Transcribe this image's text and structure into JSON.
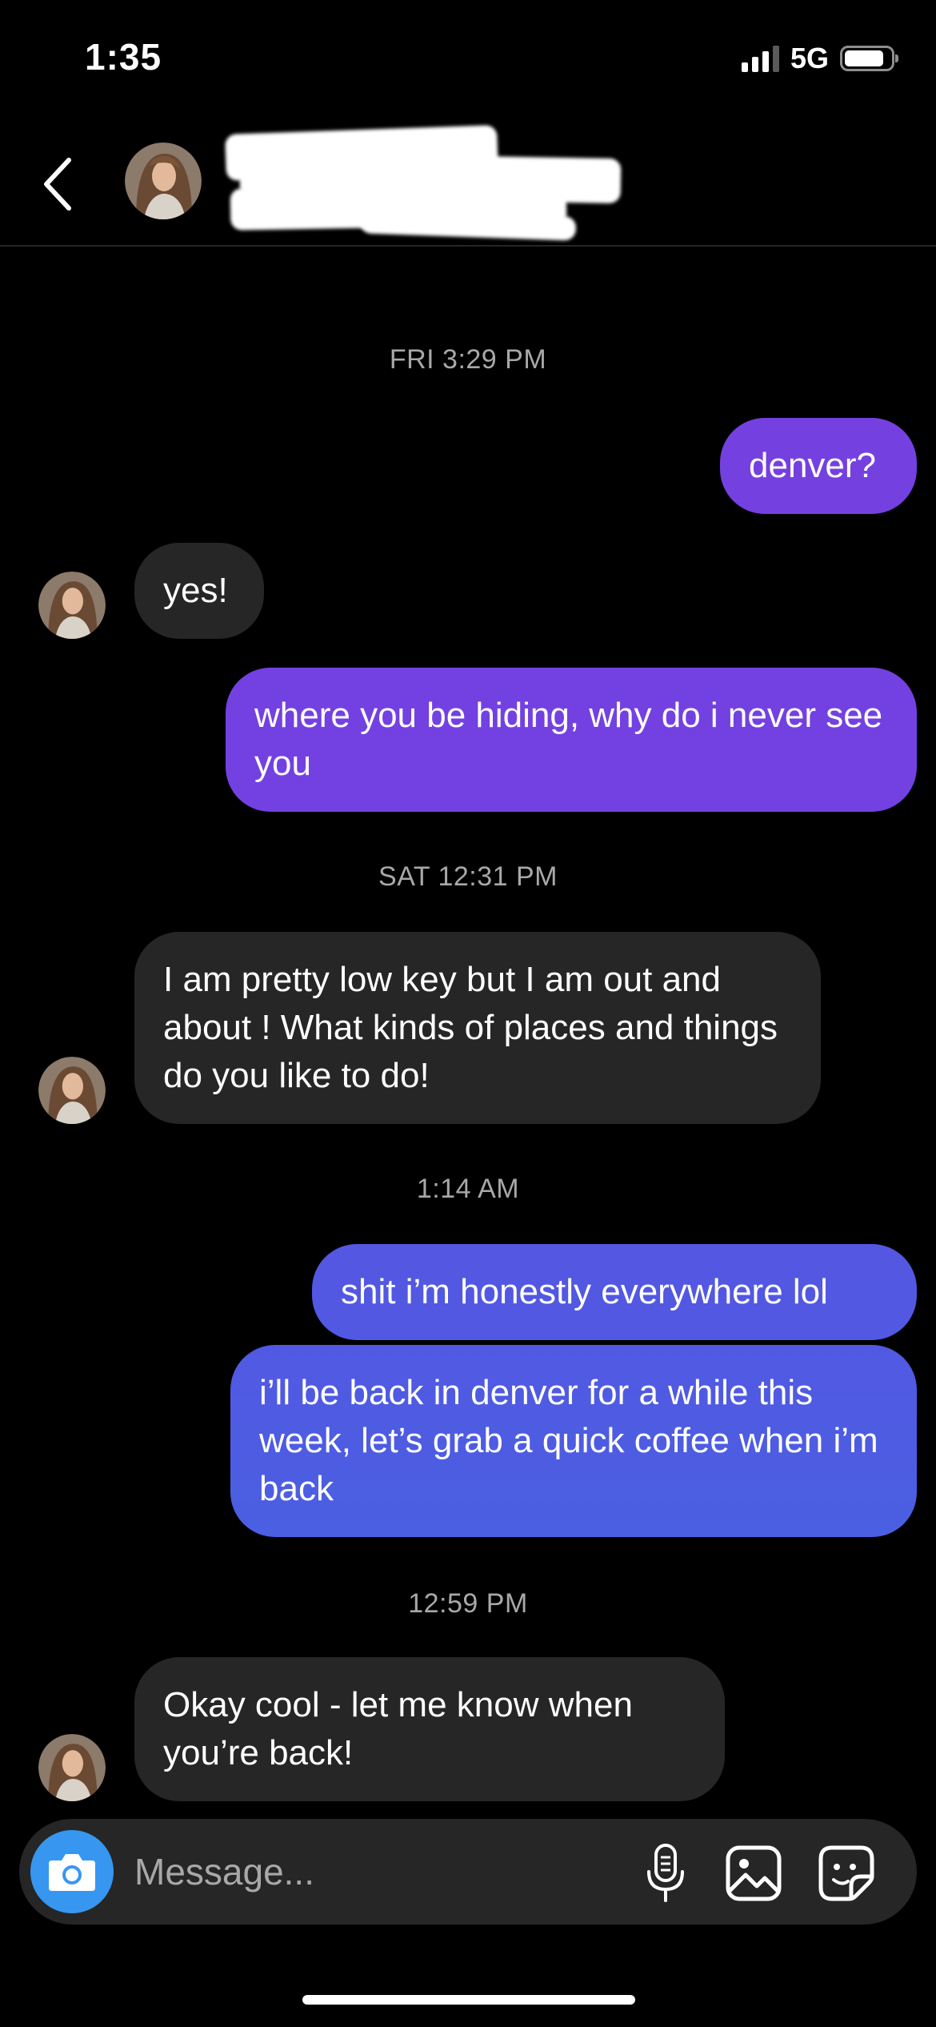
{
  "status_bar": {
    "time": "1:35",
    "network": "5G",
    "battery_level": 0.85,
    "signal_bars_active": 3
  },
  "header": {
    "contact_name_redacted": true
  },
  "thread": {
    "timestamps": [
      "FRI 3:29 PM",
      "SAT 12:31 PM",
      "1:14 AM",
      "12:59 PM"
    ],
    "messages": [
      {
        "direction": "outgoing",
        "text": "denver?"
      },
      {
        "direction": "incoming",
        "text": "yes!"
      },
      {
        "direction": "outgoing",
        "text": "where you be hiding, why do i never see you"
      },
      {
        "direction": "incoming",
        "text": "I am pretty low key but I am out and about ! What kinds of places and things do you like to do!"
      },
      {
        "direction": "outgoing",
        "text": "shit i’m honestly everywhere lol"
      },
      {
        "direction": "outgoing",
        "text": "i’ll be back in denver for a while this week, let’s grab a quick coffee when i’m back"
      },
      {
        "direction": "incoming",
        "text": "Okay cool - let me know when you’re back!"
      }
    ]
  },
  "composer": {
    "placeholder": "Message...",
    "value": "",
    "icons": [
      "camera-icon",
      "microphone-icon",
      "gallery-icon",
      "sticker-icon"
    ]
  },
  "colors": {
    "background": "#000000",
    "incoming_bubble": "#262626",
    "outgoing_purple": "#7540e0",
    "outgoing_blue": "#4f5ae3",
    "timestamp_text": "#a8a8a8",
    "camera_button": "#3797f0"
  }
}
